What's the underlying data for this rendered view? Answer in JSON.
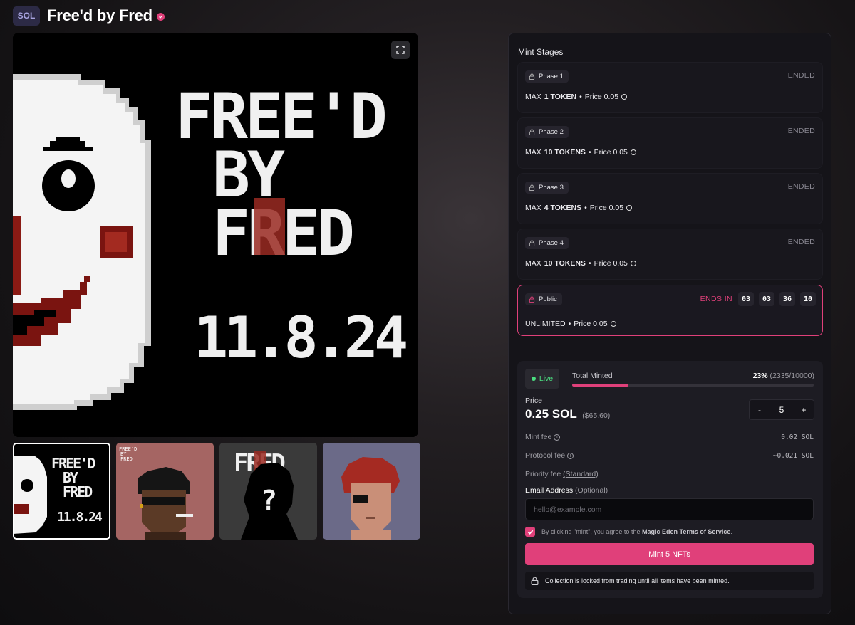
{
  "header": {
    "chain_badge": "SOL",
    "title": "Free'd by Fred"
  },
  "hero": {
    "art_text_line1": "FREE'D",
    "art_text_line2": "BY",
    "art_text_line3": "FRED",
    "art_date": "11.8.24"
  },
  "thumbnails": [
    {
      "name": "cover",
      "active": true
    },
    {
      "name": "smoker",
      "active": false
    },
    {
      "name": "mystery",
      "active": false
    },
    {
      "name": "redhead",
      "active": false
    }
  ],
  "mint_stages": {
    "title": "Mint Stages",
    "stages": [
      {
        "phase": "Phase 1",
        "status": "ENDED",
        "max_prefix": "MAX",
        "max_value": "1 TOKEN",
        "price": "Price 0.05"
      },
      {
        "phase": "Phase 2",
        "status": "ENDED",
        "max_prefix": "MAX",
        "max_value": "10 TOKENS",
        "price": "Price 0.05"
      },
      {
        "phase": "Phase 3",
        "status": "ENDED",
        "max_prefix": "MAX",
        "max_value": "4 TOKENS",
        "price": "Price 0.05"
      },
      {
        "phase": "Phase 4",
        "status": "ENDED",
        "max_prefix": "MAX",
        "max_value": "10 TOKENS",
        "price": "Price 0.05"
      }
    ],
    "public": {
      "phase": "Public",
      "ends_label": "ENDS IN",
      "countdown": [
        "03",
        "03",
        "36",
        "10"
      ],
      "limit": "UNLIMITED",
      "price": "Price 0.05"
    }
  },
  "mint": {
    "live_label": "Live",
    "total_minted_label": "Total Minted",
    "minted_pct": "23%",
    "minted_counts": "(2335/10000)",
    "minted_fraction": 0.2335,
    "price_label": "Price",
    "price_value": "0.25 SOL",
    "price_usd": "($65.60)",
    "quantity": "5",
    "qty_minus": "-",
    "qty_plus": "+",
    "mint_fee_label": "Mint fee",
    "mint_fee_value": "0.02 SOL",
    "protocol_fee_label": "Protocol fee",
    "protocol_fee_value": "~0.021 SOL",
    "priority_fee_label": "Priority fee",
    "priority_fee_link": "(Standard)",
    "email_label": "Email Address",
    "email_optional": "(Optional)",
    "email_placeholder": "hello@example.com",
    "terms_prefix": "By clicking \"mint\", you agree to the",
    "terms_link": "Magic Eden Terms of Service",
    "terms_suffix": ".",
    "mint_button": "Mint 5 NFTs",
    "locked_note": "Collection is locked from trading until all items have been minted."
  },
  "colors": {
    "accent": "#e0407a",
    "live_green": "#4ade80",
    "panel_bg": "#151419"
  }
}
